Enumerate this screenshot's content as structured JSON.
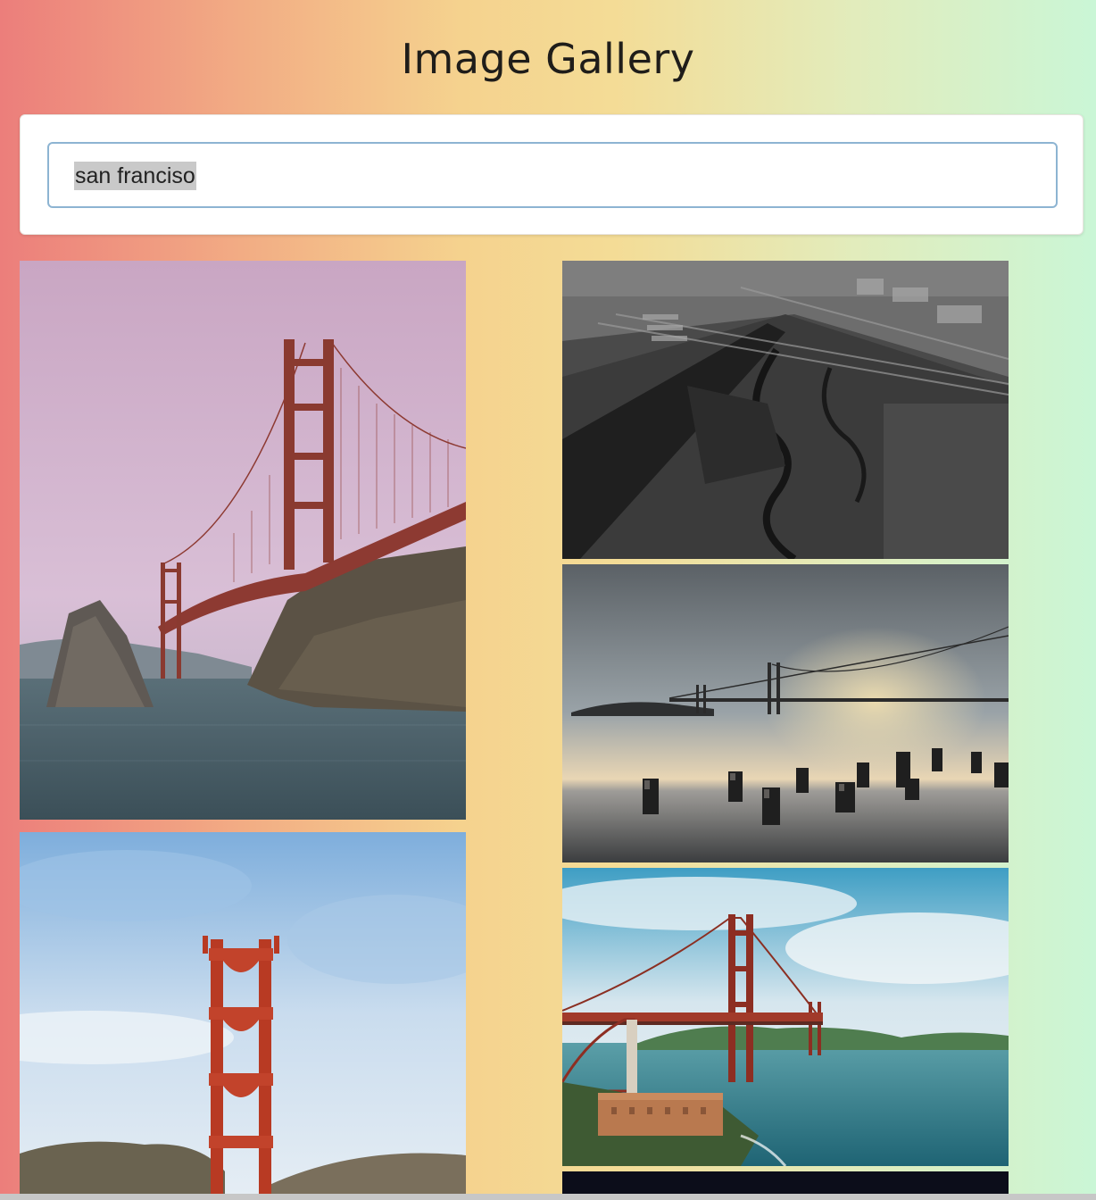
{
  "header": {
    "title": "Image Gallery"
  },
  "search": {
    "value": "san franciso"
  },
  "gallery": {
    "images": [
      {
        "icon": "golden-gate-bridge-pink-sky-photo"
      },
      {
        "icon": "aerial-bw-bay-marsh-photo"
      },
      {
        "icon": "bay-bridge-sunset-pilings-photo"
      },
      {
        "icon": "golden-gate-tower-blue-sky-photo"
      },
      {
        "icon": "golden-gate-fort-point-photo"
      },
      {
        "icon": "dark-night-photo"
      }
    ]
  },
  "colors": {
    "gradient_left": "#ec7e7b",
    "gradient_mid": "#f5d28e",
    "gradient_right": "#caf6d6",
    "input_border": "#8db4d2",
    "bridge_red": "#9a3f34"
  }
}
